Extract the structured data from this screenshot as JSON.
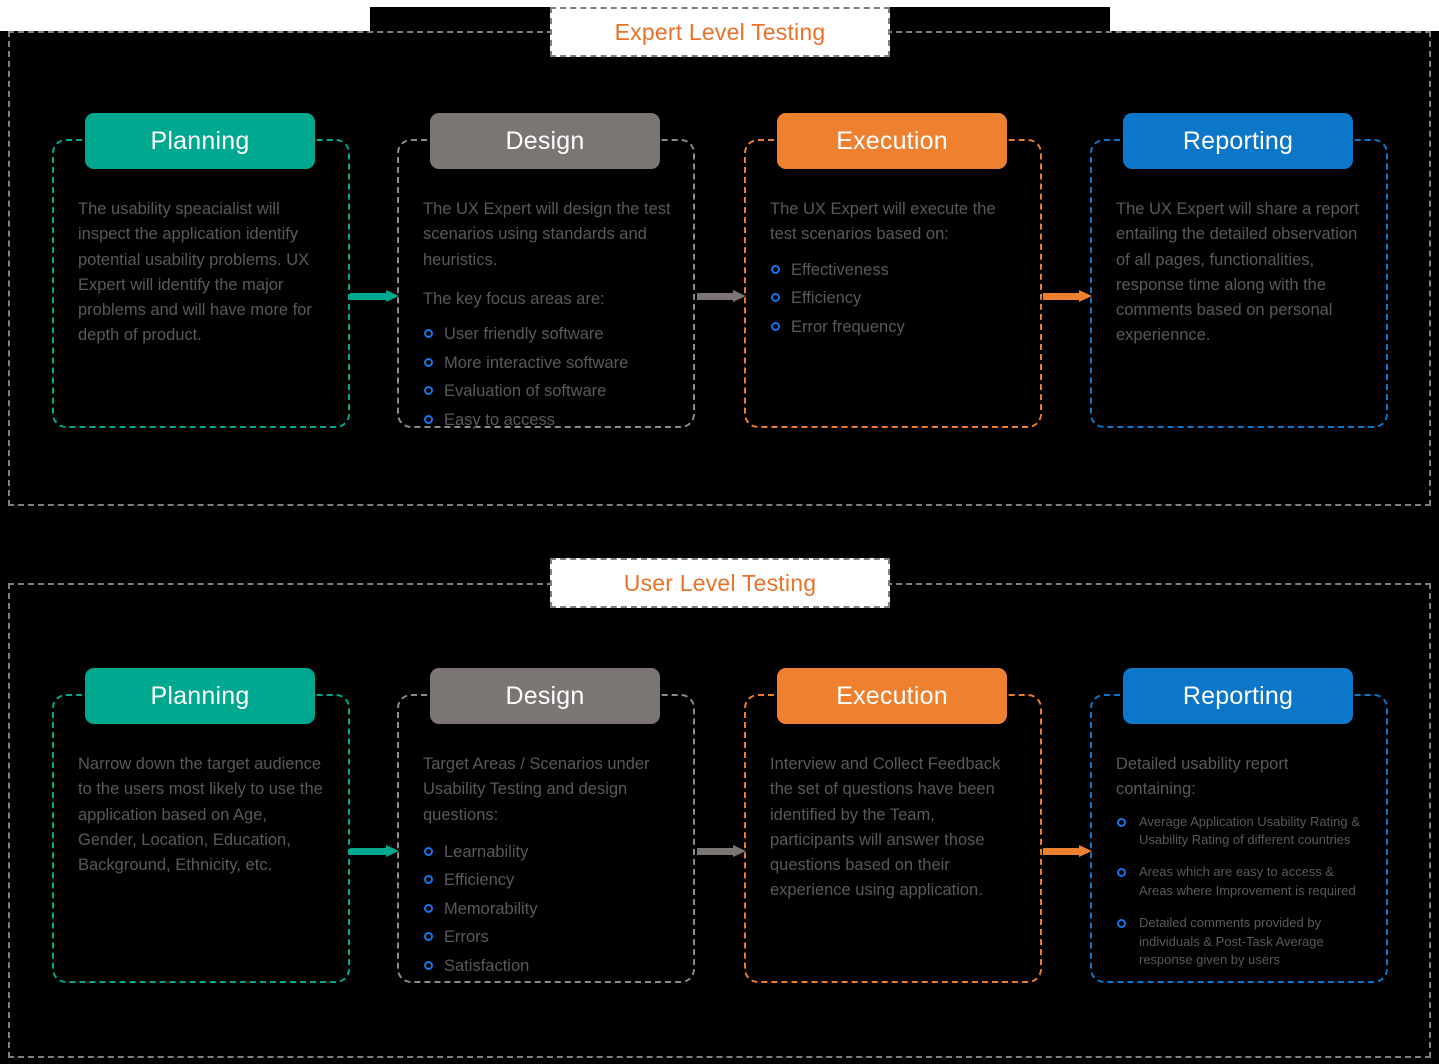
{
  "sections": [
    {
      "title": "Expert Level Testing",
      "columns": [
        {
          "header": "Planning",
          "color": "#00A88F",
          "paragraphs": [
            "The usability speacialist will inspect the application identify potential usability problems. UX Expert will identify the major problems and will have more for depth of product."
          ],
          "bullets": []
        },
        {
          "header": "Design",
          "color": "#7B7574",
          "paragraphs": [
            "The UX Expert will design the test scenarios using standards and heuristics.",
            "The key focus areas are:"
          ],
          "bullets": [
            "User friendly software",
            "More interactive software",
            "Evaluation of software",
            "Easy to access"
          ]
        },
        {
          "header": "Execution",
          "color": "#EE8130",
          "paragraphs": [
            "The UX Expert will execute the test scenarios based on:"
          ],
          "bullets": [
            "Effectiveness",
            "Efficiency",
            "Error frequency"
          ]
        },
        {
          "header": "Reporting",
          "color": "#0C76C8",
          "paragraphs": [
            "The UX Expert will share a report entailing the detailed observation of all pages, functionalities, response time along with the comments based on personal experiennce."
          ],
          "bullets": []
        }
      ],
      "arrows": [
        "#00A88F",
        "#7B7574",
        "#EE8130"
      ]
    },
    {
      "title": "User Level Testing",
      "columns": [
        {
          "header": "Planning",
          "color": "#00A88F",
          "paragraphs": [
            "Narrow down the target audience to the users most likely to use the application based on Age, Gender, Location, Education, Background, Ethnicity, etc."
          ],
          "bullets": []
        },
        {
          "header": "Design",
          "color": "#7B7574",
          "paragraphs": [
            "Target Areas / Scenarios under Usability Testing and design questions:"
          ],
          "bullets": [
            "Learnability",
            "Efficiency",
            "Memorability",
            "Errors",
            "Satisfaction"
          ]
        },
        {
          "header": "Execution",
          "color": "#EE8130",
          "paragraphs": [
            "Interview and Collect Feedback the set of questions have been identified by the Team, participants will answer those questions based on their experience using application."
          ],
          "bullets": []
        },
        {
          "header": "Reporting",
          "color": "#0C76C8",
          "paragraphs": [
            "Detailed usability report containing:"
          ],
          "bullets": [
            "Average Application Usability Rating & Usability Rating of different countries",
            "Areas which are easy to access & Areas where Improvement is required",
            "Detailed comments provided by individuals & Post-Task Average response given by users"
          ]
        }
      ],
      "arrows": [
        "#00A88F",
        "#7B7574",
        "#EE8130"
      ]
    }
  ],
  "palette": {
    "teal": "#00A88F",
    "gray": "#7B7574",
    "orange": "#EE8130",
    "blue": "#0C76C8",
    "title_text": "#E8722A",
    "body_text": "#58595B",
    "dash_gray": "#7f7f7f",
    "bullet_blue": "#1a73e8",
    "background": "#000000"
  }
}
